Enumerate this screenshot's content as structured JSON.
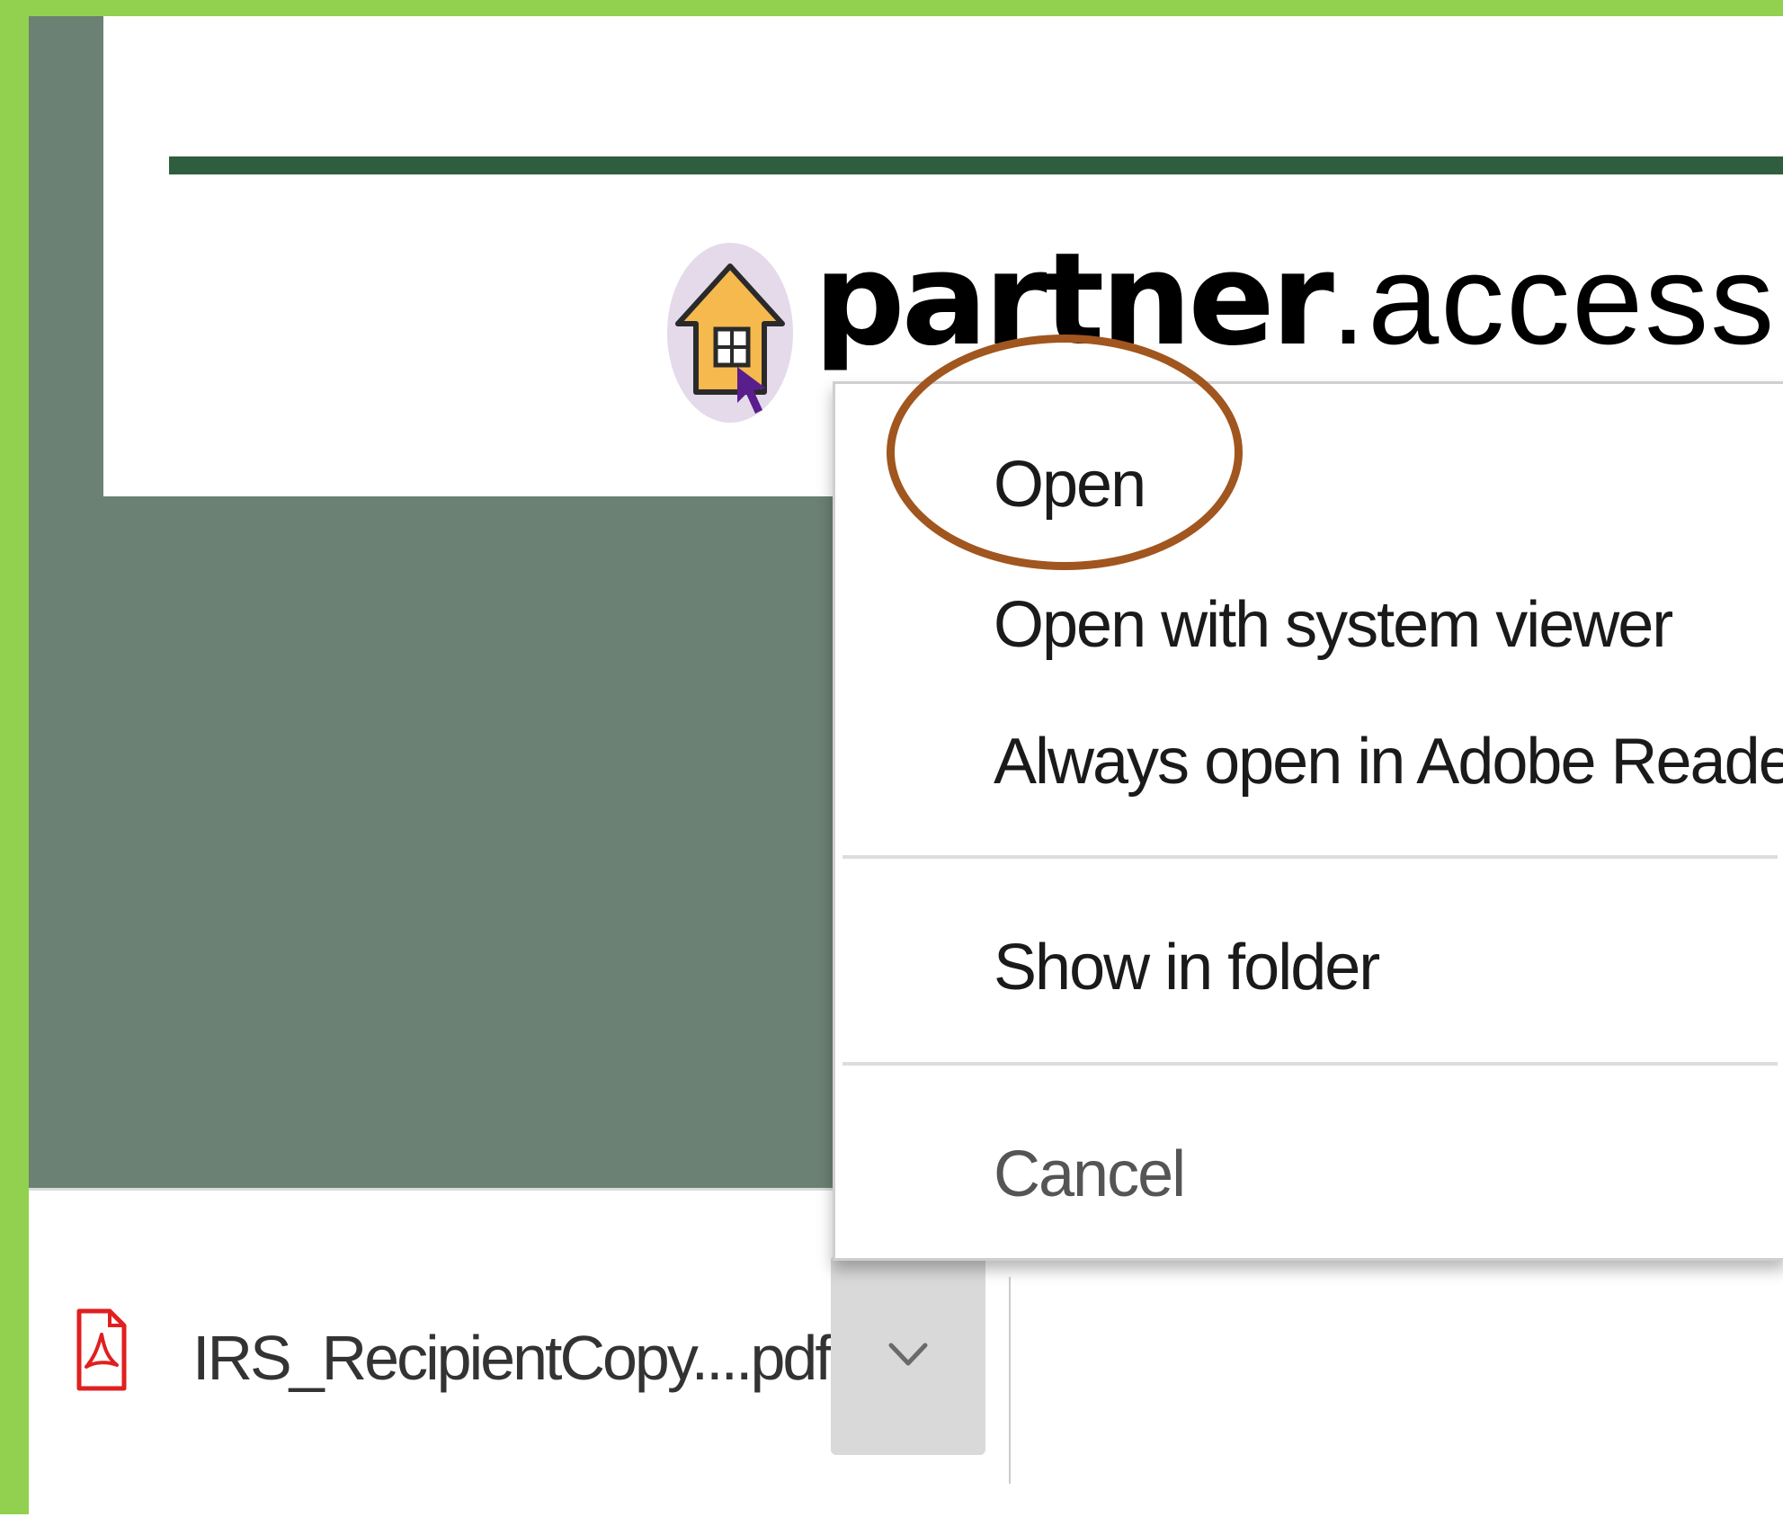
{
  "logo": {
    "brand_bold": "partner",
    "brand_light": ".access"
  },
  "context_menu": {
    "items": [
      {
        "label": "Open"
      },
      {
        "label": "Open with system viewer"
      },
      {
        "label": "Always open in Adobe Reader"
      },
      {
        "label": "Show in folder"
      },
      {
        "label": "Cancel"
      }
    ]
  },
  "download_bar": {
    "file_name": "IRS_RecipientCopy....pdf",
    "file_icon": "pdf-file-icon",
    "options_icon": "chevron-down-icon"
  },
  "colors": {
    "frame": "#92d050",
    "page_background": "#6b8173",
    "header_rule": "#2e5e3e",
    "annotation_circle": "#a0561e",
    "pdf_icon": "#e02020"
  }
}
